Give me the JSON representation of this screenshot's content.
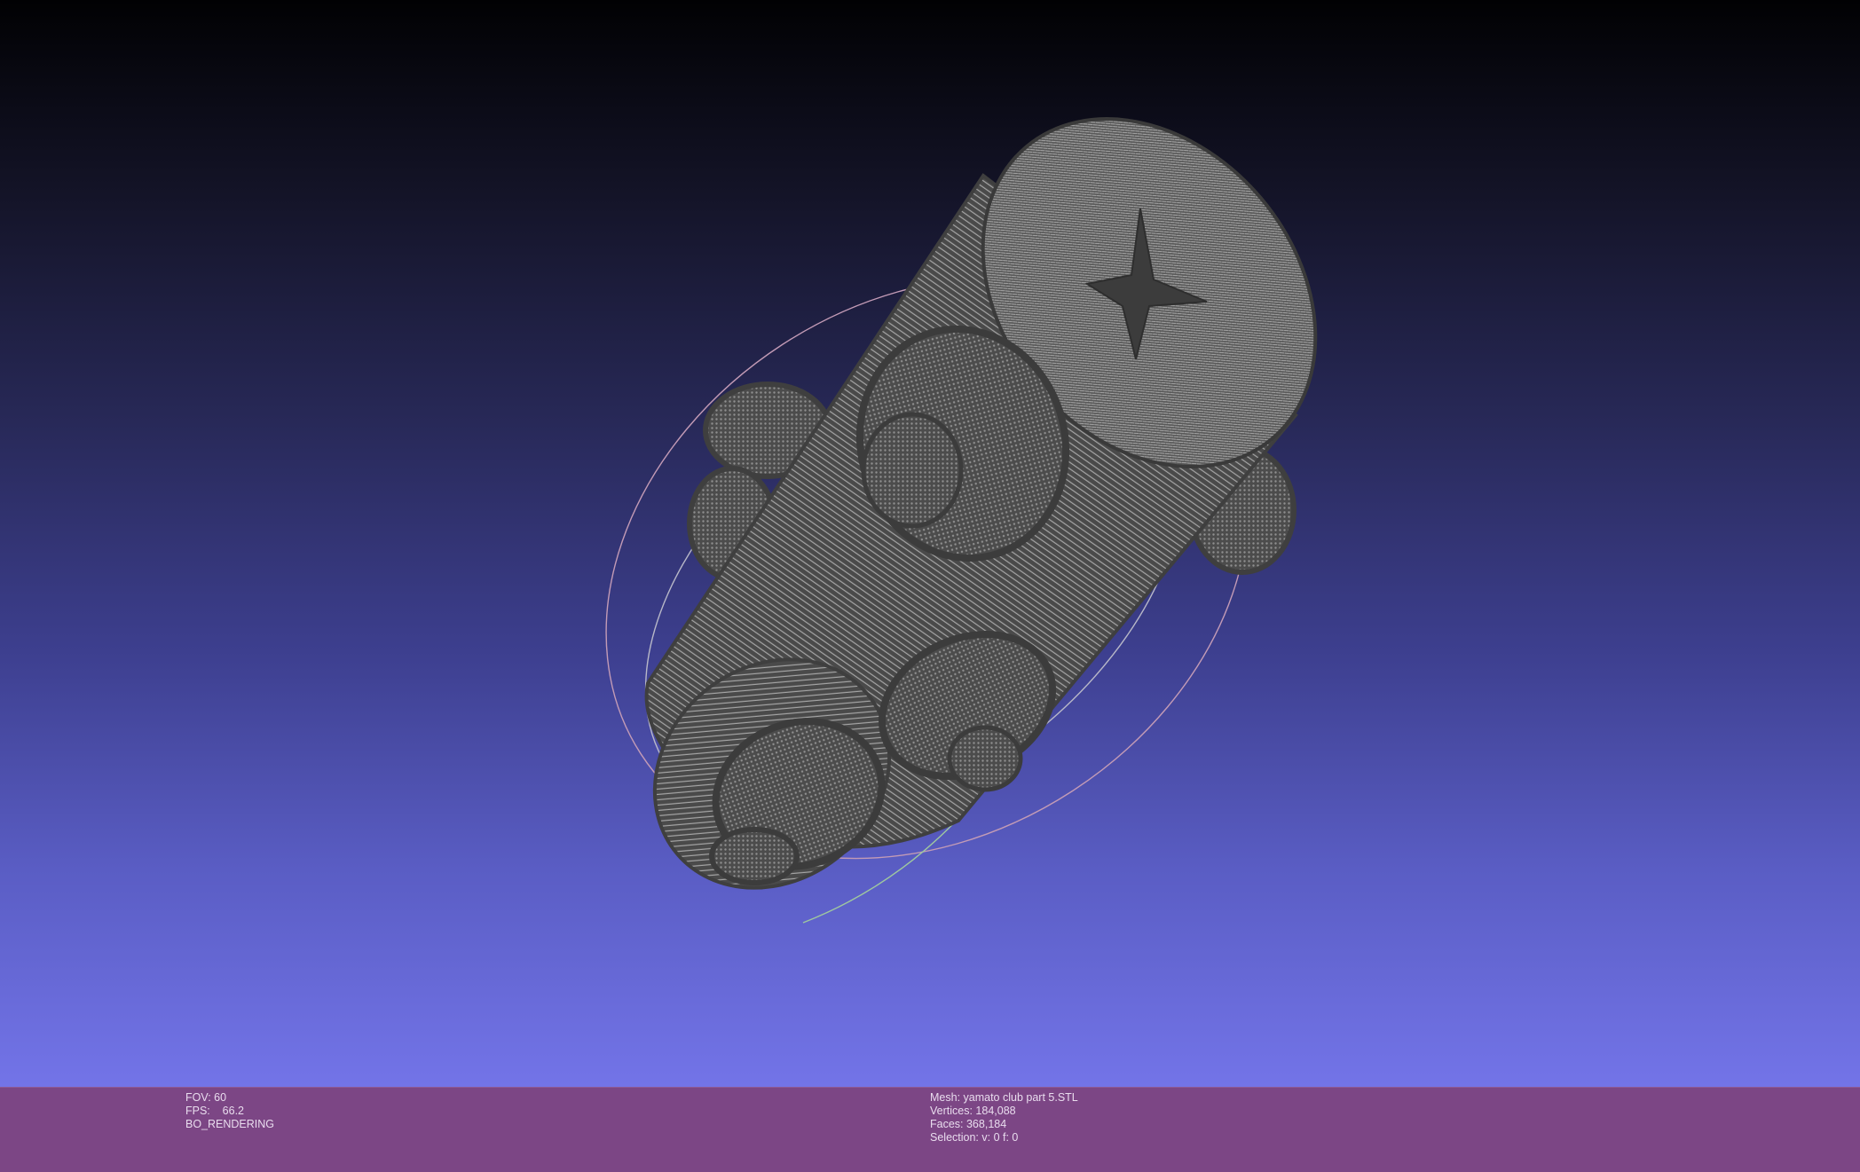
{
  "viewport": {
    "mesh_color": "#4a4a4a",
    "wire_color": "#9c9c9c",
    "trackball_colors": [
      "#c39bb6",
      "#b8b8c8",
      "#9fc89f"
    ]
  },
  "status": {
    "fov": "FOV: 60",
    "fps": "FPS:    66.2",
    "render_mode": "BO_RENDERING",
    "mesh": "Mesh: yamato club part 5.STL",
    "vertices": "Vertices: 184,088",
    "faces": "Faces: 368,184",
    "selection": "Selection: v: 0 f: 0"
  }
}
